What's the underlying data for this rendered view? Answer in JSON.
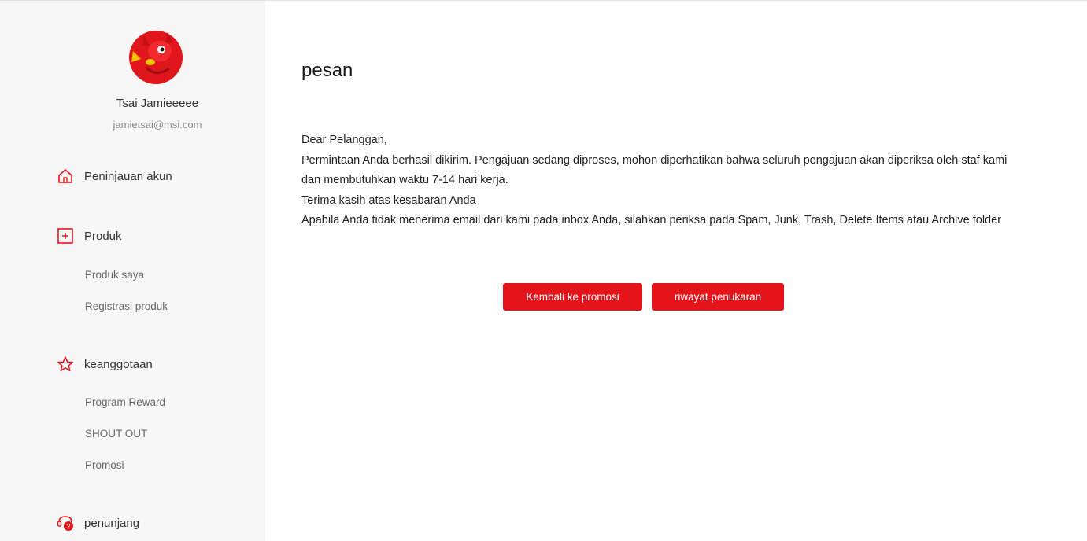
{
  "user": {
    "name": "Tsai Jamieeeee",
    "email": "jamietsai@msi.com",
    "avatar_icon": "red-dragon-mascot"
  },
  "sidebar": {
    "sections": [
      {
        "label": "Peninjauan akun",
        "icon": "home-icon",
        "items": []
      },
      {
        "label": "Produk",
        "icon": "product-box-icon",
        "items": [
          "Produk saya",
          "Registrasi produk"
        ]
      },
      {
        "label": "keanggotaan",
        "icon": "star-icon",
        "items": [
          "Program Reward",
          "SHOUT OUT",
          "Promosi"
        ]
      },
      {
        "label": "penunjang",
        "icon": "support-chat-icon",
        "items": []
      }
    ]
  },
  "main": {
    "title": "pesan",
    "message_lines": [
      "Dear Pelanggan,",
      "Permintaan Anda berhasil dikirim. Pengajuan sedang diproses, mohon diperhatikan bahwa seluruh pengajuan akan diperiksa oleh staf kami dan membutuhkan waktu 7-14 hari kerja.",
      "Terima kasih atas kesabaran Anda",
      "Apabila Anda tidak menerima email dari kami pada inbox Anda, silahkan periksa pada Spam, Junk, Trash, Delete Items atau Archive folder"
    ],
    "buttons": {
      "back_label": "Kembali ke promosi",
      "history_label": "riwayat penukaran"
    }
  },
  "colors": {
    "accent": "#e5141b",
    "sidebar_bg": "#f7f7f7"
  }
}
